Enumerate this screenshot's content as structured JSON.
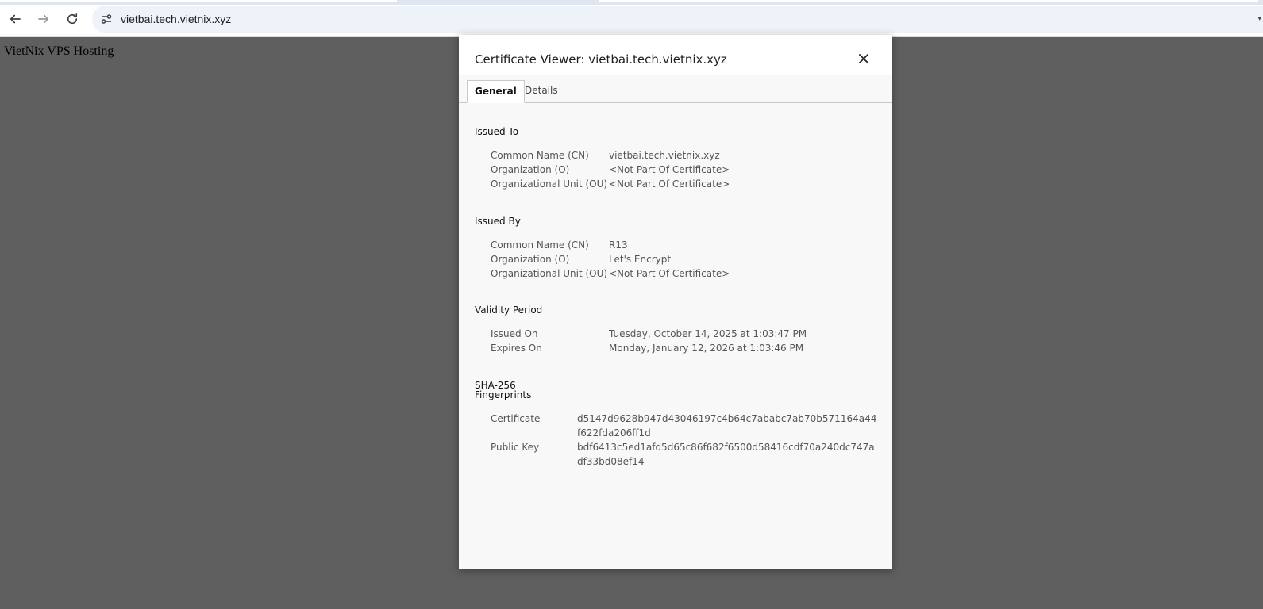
{
  "browser": {
    "url": "vietbai.tech.vietnix.xyz",
    "icons": {
      "back": "back-arrow-icon",
      "forward": "forward-arrow-icon",
      "reload": "reload-icon",
      "site_info": "site-settings-icon"
    }
  },
  "page": {
    "text": "VietNix VPS Hosting"
  },
  "dialog": {
    "title": "Certificate Viewer: vietbai.tech.vietnix.xyz",
    "close_icon": "close-icon",
    "tabs": [
      {
        "label": "General",
        "active": true
      },
      {
        "label": "Details",
        "active": false
      }
    ],
    "issued_to": {
      "title": "Issued To",
      "rows": [
        {
          "label": "Common Name (CN)",
          "value": "vietbai.tech.vietnix.xyz"
        },
        {
          "label": "Organization (O)",
          "value": "<Not Part Of Certificate>"
        },
        {
          "label": "Organizational Unit (OU)",
          "value": "<Not Part Of Certificate>"
        }
      ]
    },
    "issued_by": {
      "title": "Issued By",
      "rows": [
        {
          "label": "Common Name (CN)",
          "value": "R13"
        },
        {
          "label": "Organization (O)",
          "value": "Let's Encrypt"
        },
        {
          "label": "Organizational Unit (OU)",
          "value": "<Not Part Of Certificate>"
        }
      ]
    },
    "validity": {
      "title": "Validity Period",
      "rows": [
        {
          "label": "Issued On",
          "value": "Tuesday, October 14, 2025 at 1:03:47 PM"
        },
        {
          "label": "Expires On",
          "value": "Monday, January 12, 2026 at 1:03:46 PM"
        }
      ]
    },
    "fingerprints": {
      "title_line1": "SHA-256",
      "title_line2": "Fingerprints",
      "rows": [
        {
          "label": "Certificate",
          "value": "d5147d9628b947d43046197c4b64c7ababc7ab70b571164a44f622fda206ff1d"
        },
        {
          "label": "Public Key",
          "value": "bdf6413c5ed1afd5d65c86f682f6500d58416cdf70a240dc747adf33bd08ef14"
        }
      ]
    }
  }
}
